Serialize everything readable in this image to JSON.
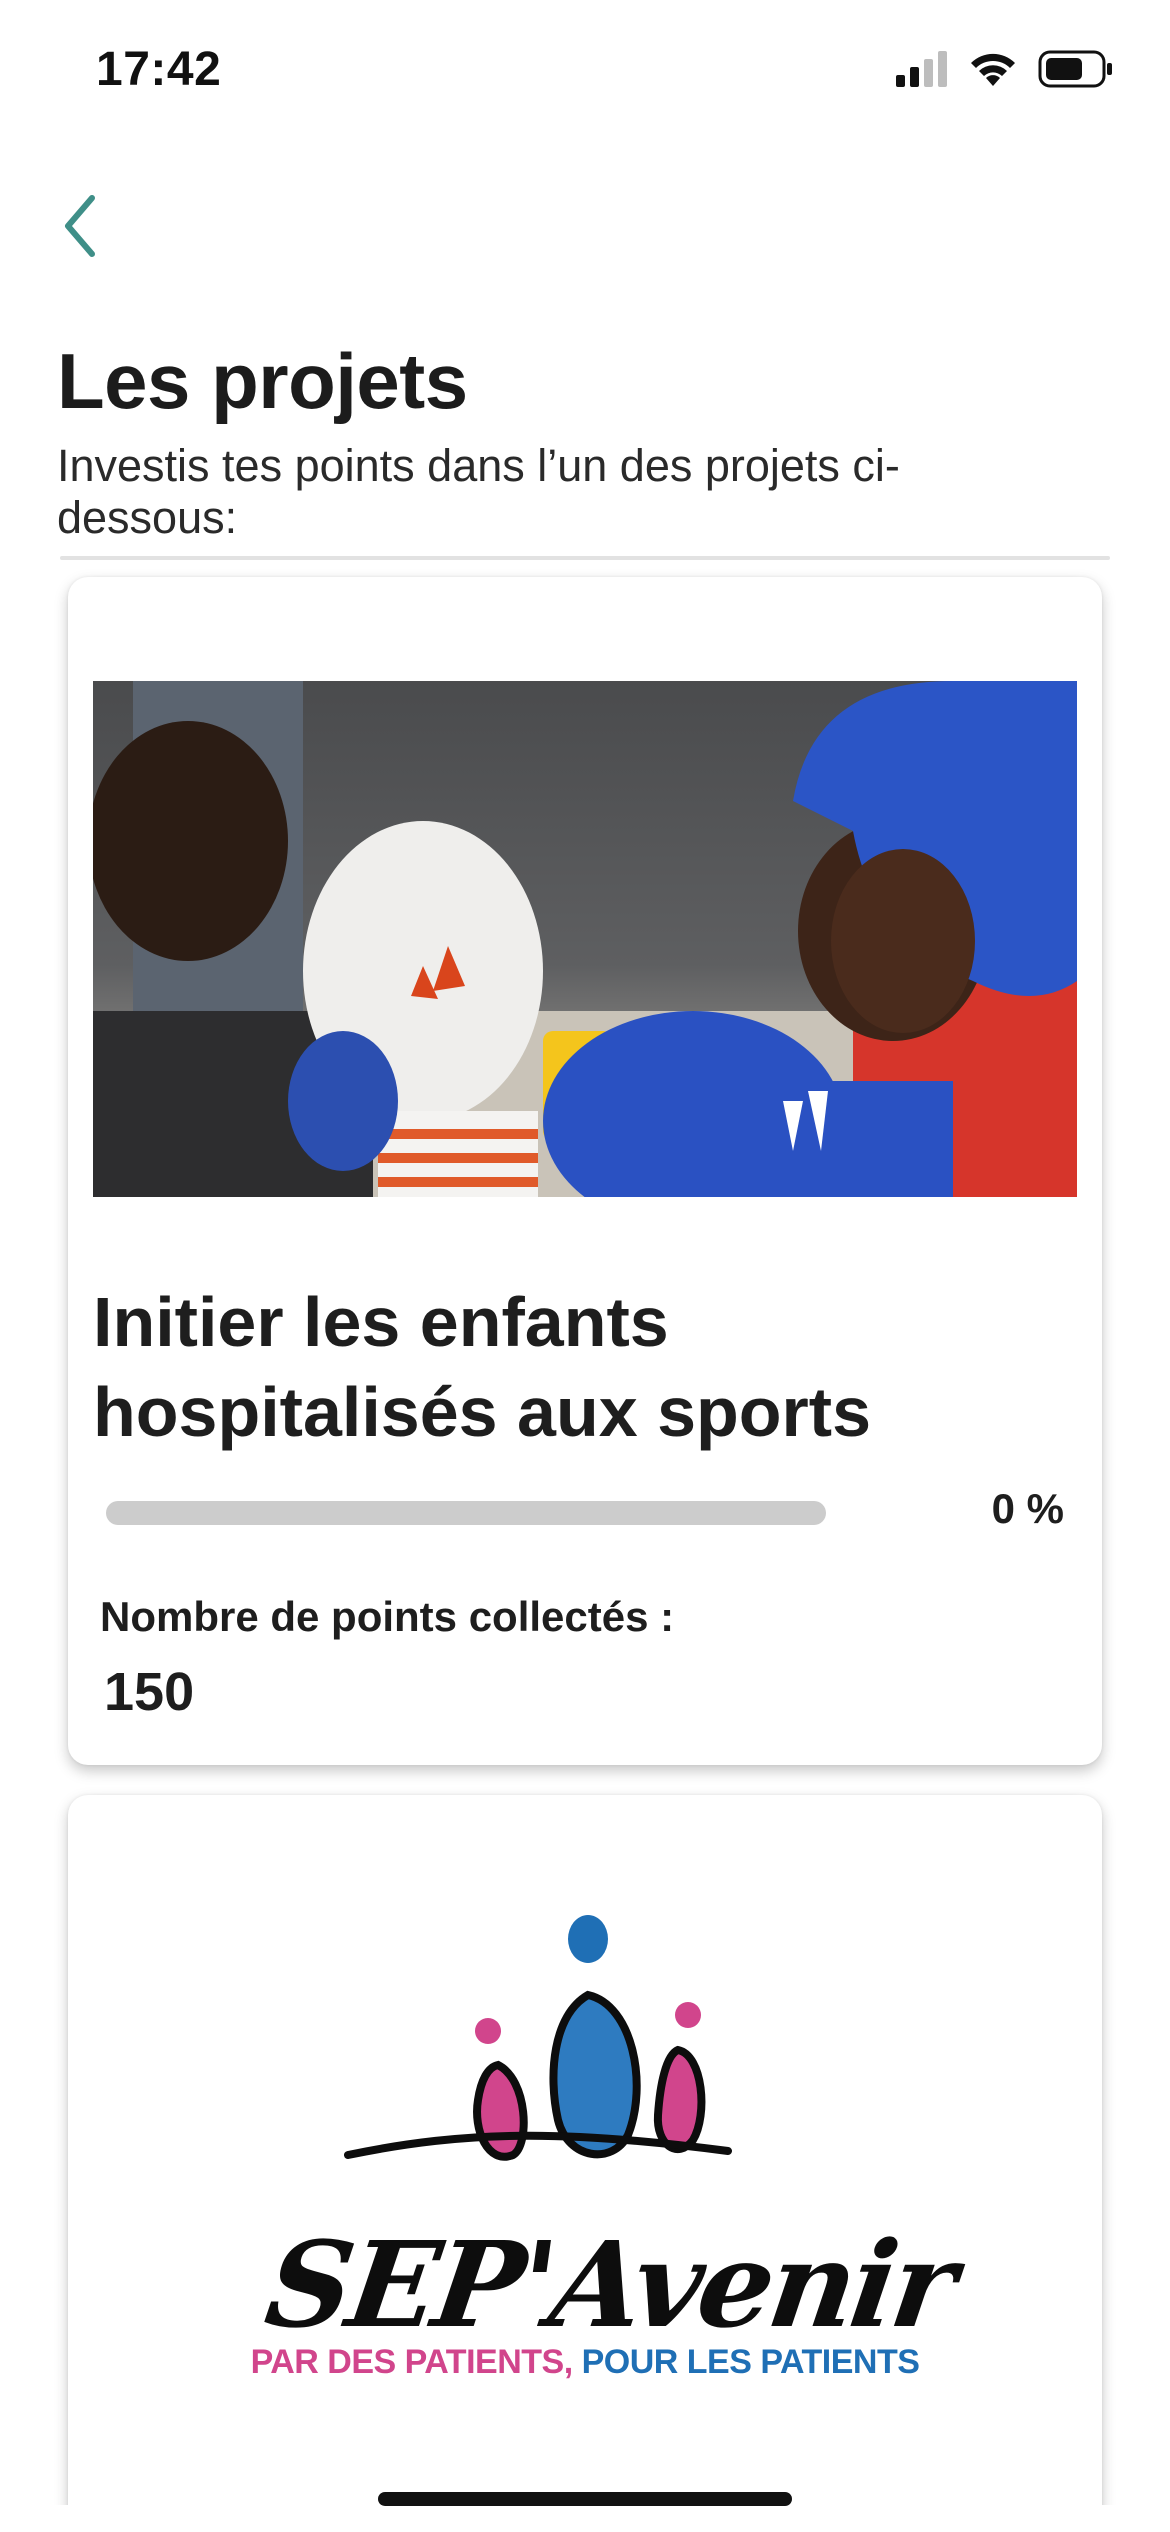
{
  "status_bar": {
    "time": "17:42",
    "icons": [
      "cellular-signal-icon",
      "wifi-icon",
      "battery-icon"
    ]
  },
  "header": {
    "back_icon": "chevron-left-icon",
    "title": "Les projets",
    "subtitle": "Investis tes points dans l’un des projets ci-dessous:"
  },
  "projects": [
    {
      "image": "children boxing photo",
      "title": "Initier les enfants hospitalisés aux sports",
      "progress_percent": 0,
      "progress_label": "0 %",
      "points_label": "Nombre de points collectés :",
      "points_value": "150"
    },
    {
      "logo_text": "SEP'Avenir",
      "tagline_part1": "PAR DES PATIENTS,",
      "tagline_part2": "POUR LES PATIENTS"
    }
  ],
  "colors": {
    "accent": "#3f8f88",
    "logo_pink": "#d1458c",
    "logo_blue": "#1f6fb5",
    "progress_track": "#cccccc"
  }
}
